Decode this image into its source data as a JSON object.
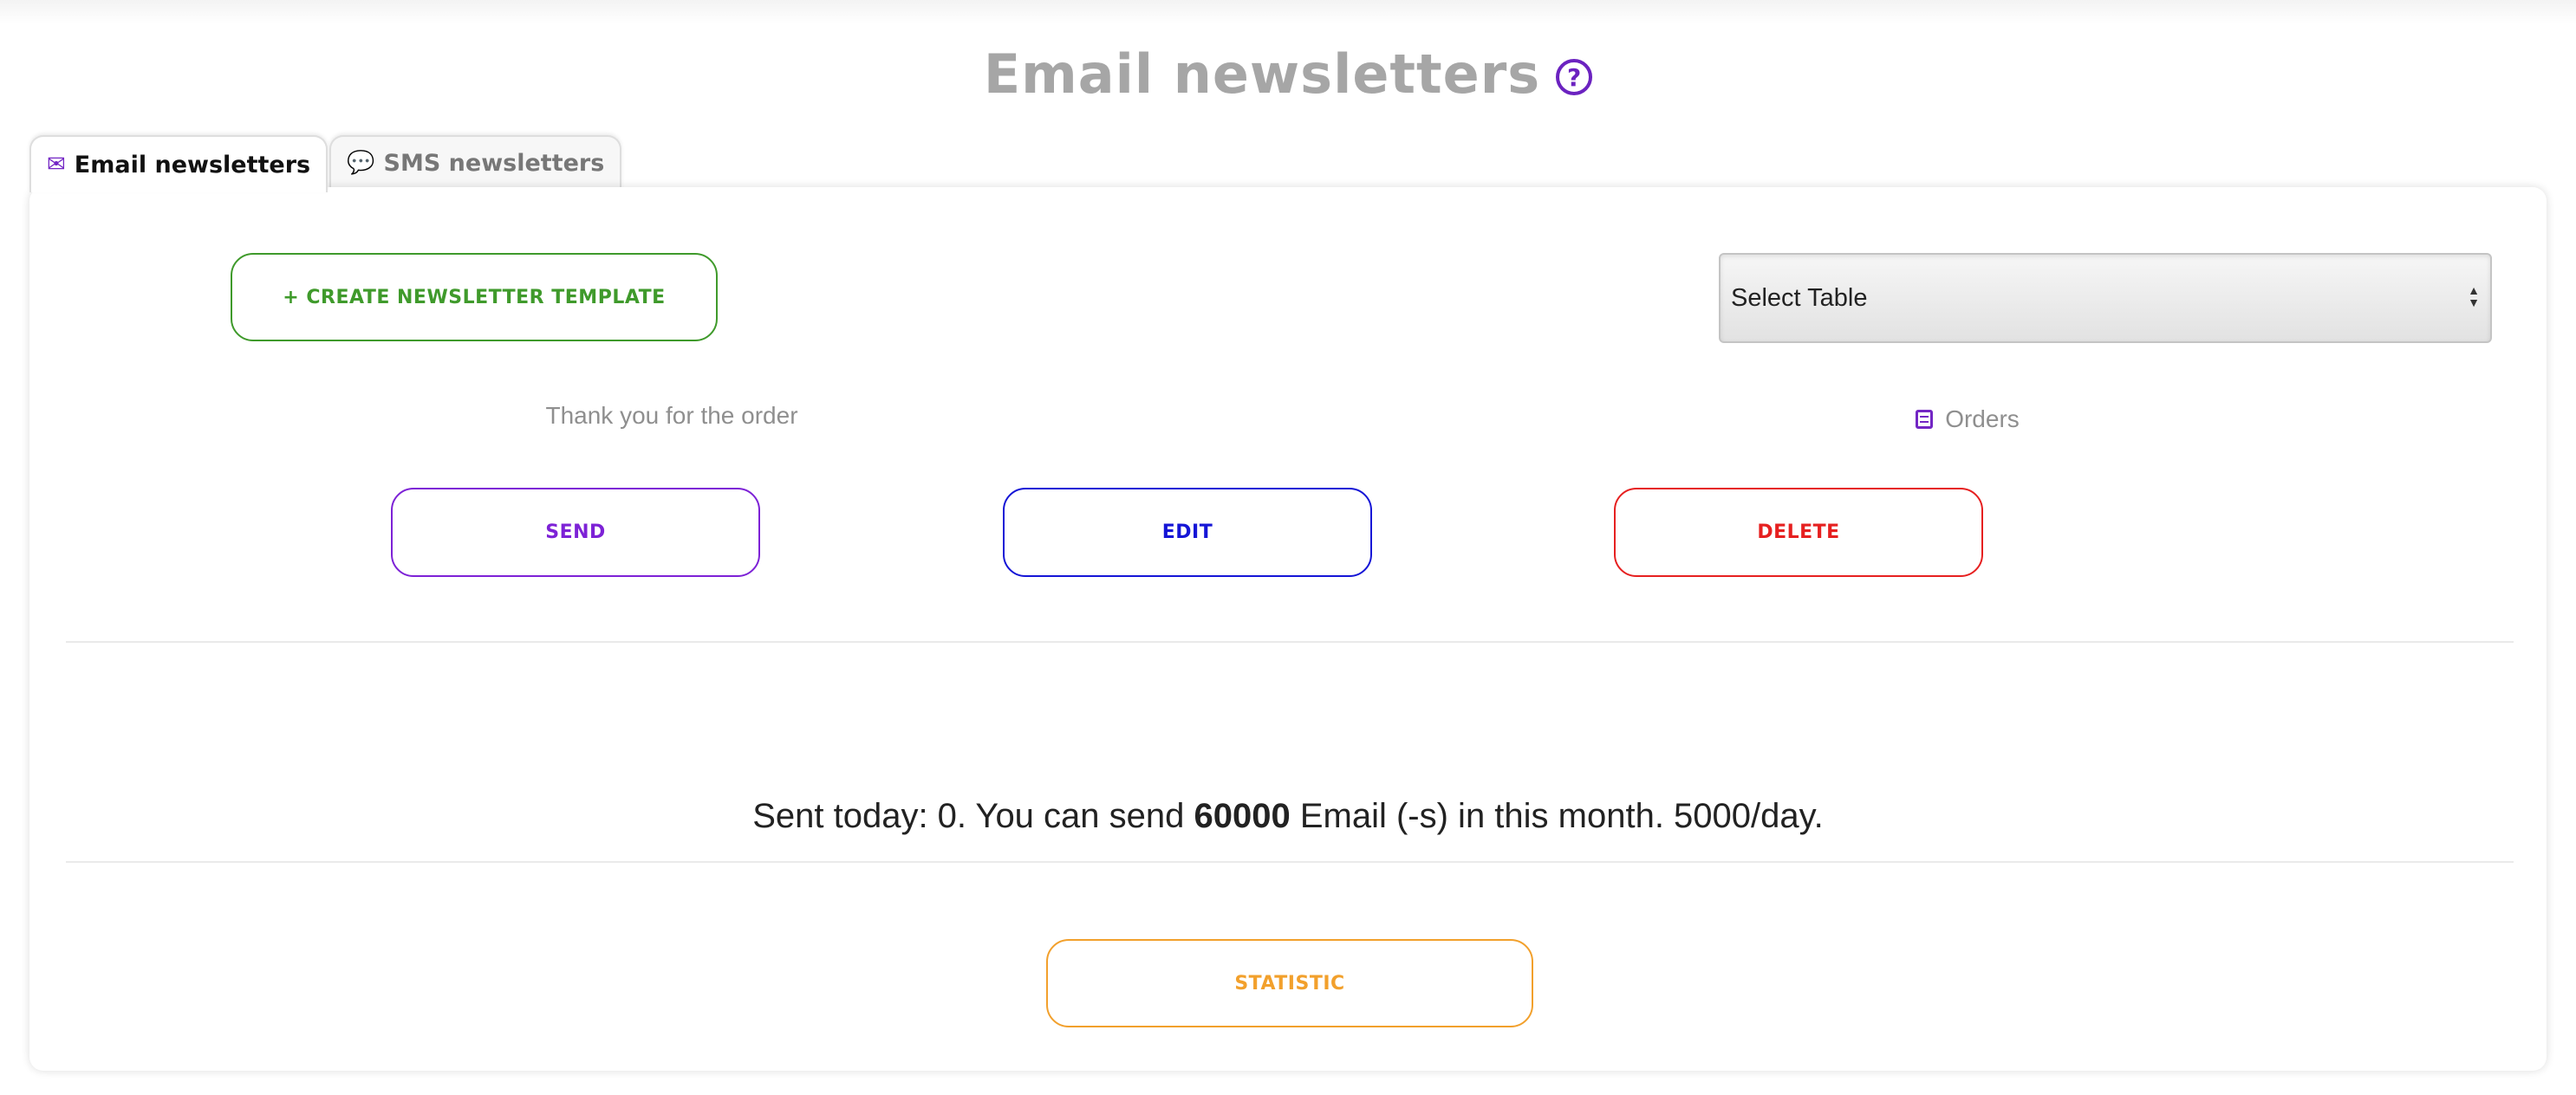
{
  "page": {
    "title": "Email newsletters",
    "help_icon": "question-circle-icon"
  },
  "tabs": [
    {
      "label": "Email newsletters",
      "icon": "envelope-icon",
      "active": true
    },
    {
      "label": "SMS newsletters",
      "icon": "comment-icon",
      "active": false
    }
  ],
  "actions": {
    "create_label": "+ CREATE NEWSLETTER TEMPLATE",
    "table_select": {
      "value": "Select Table"
    }
  },
  "template": {
    "name": "Thank you for the order",
    "table_name": "Orders",
    "table_icon": "table-icon",
    "send_label": "SEND",
    "edit_label": "EDIT",
    "delete_label": "DELETE"
  },
  "stats": {
    "prefix": "Sent today: 0. You can send ",
    "monthly_limit": "60000",
    "suffix": " Email (-s) in this month. 5000/day.",
    "statistic_label": "STATISTIC"
  },
  "colors": {
    "create": "#3f9a2b",
    "send": "#7d22d6",
    "edit": "#1515d6",
    "delete": "#e62020",
    "statistic": "#f2a02c",
    "accent": "#7326c4"
  }
}
